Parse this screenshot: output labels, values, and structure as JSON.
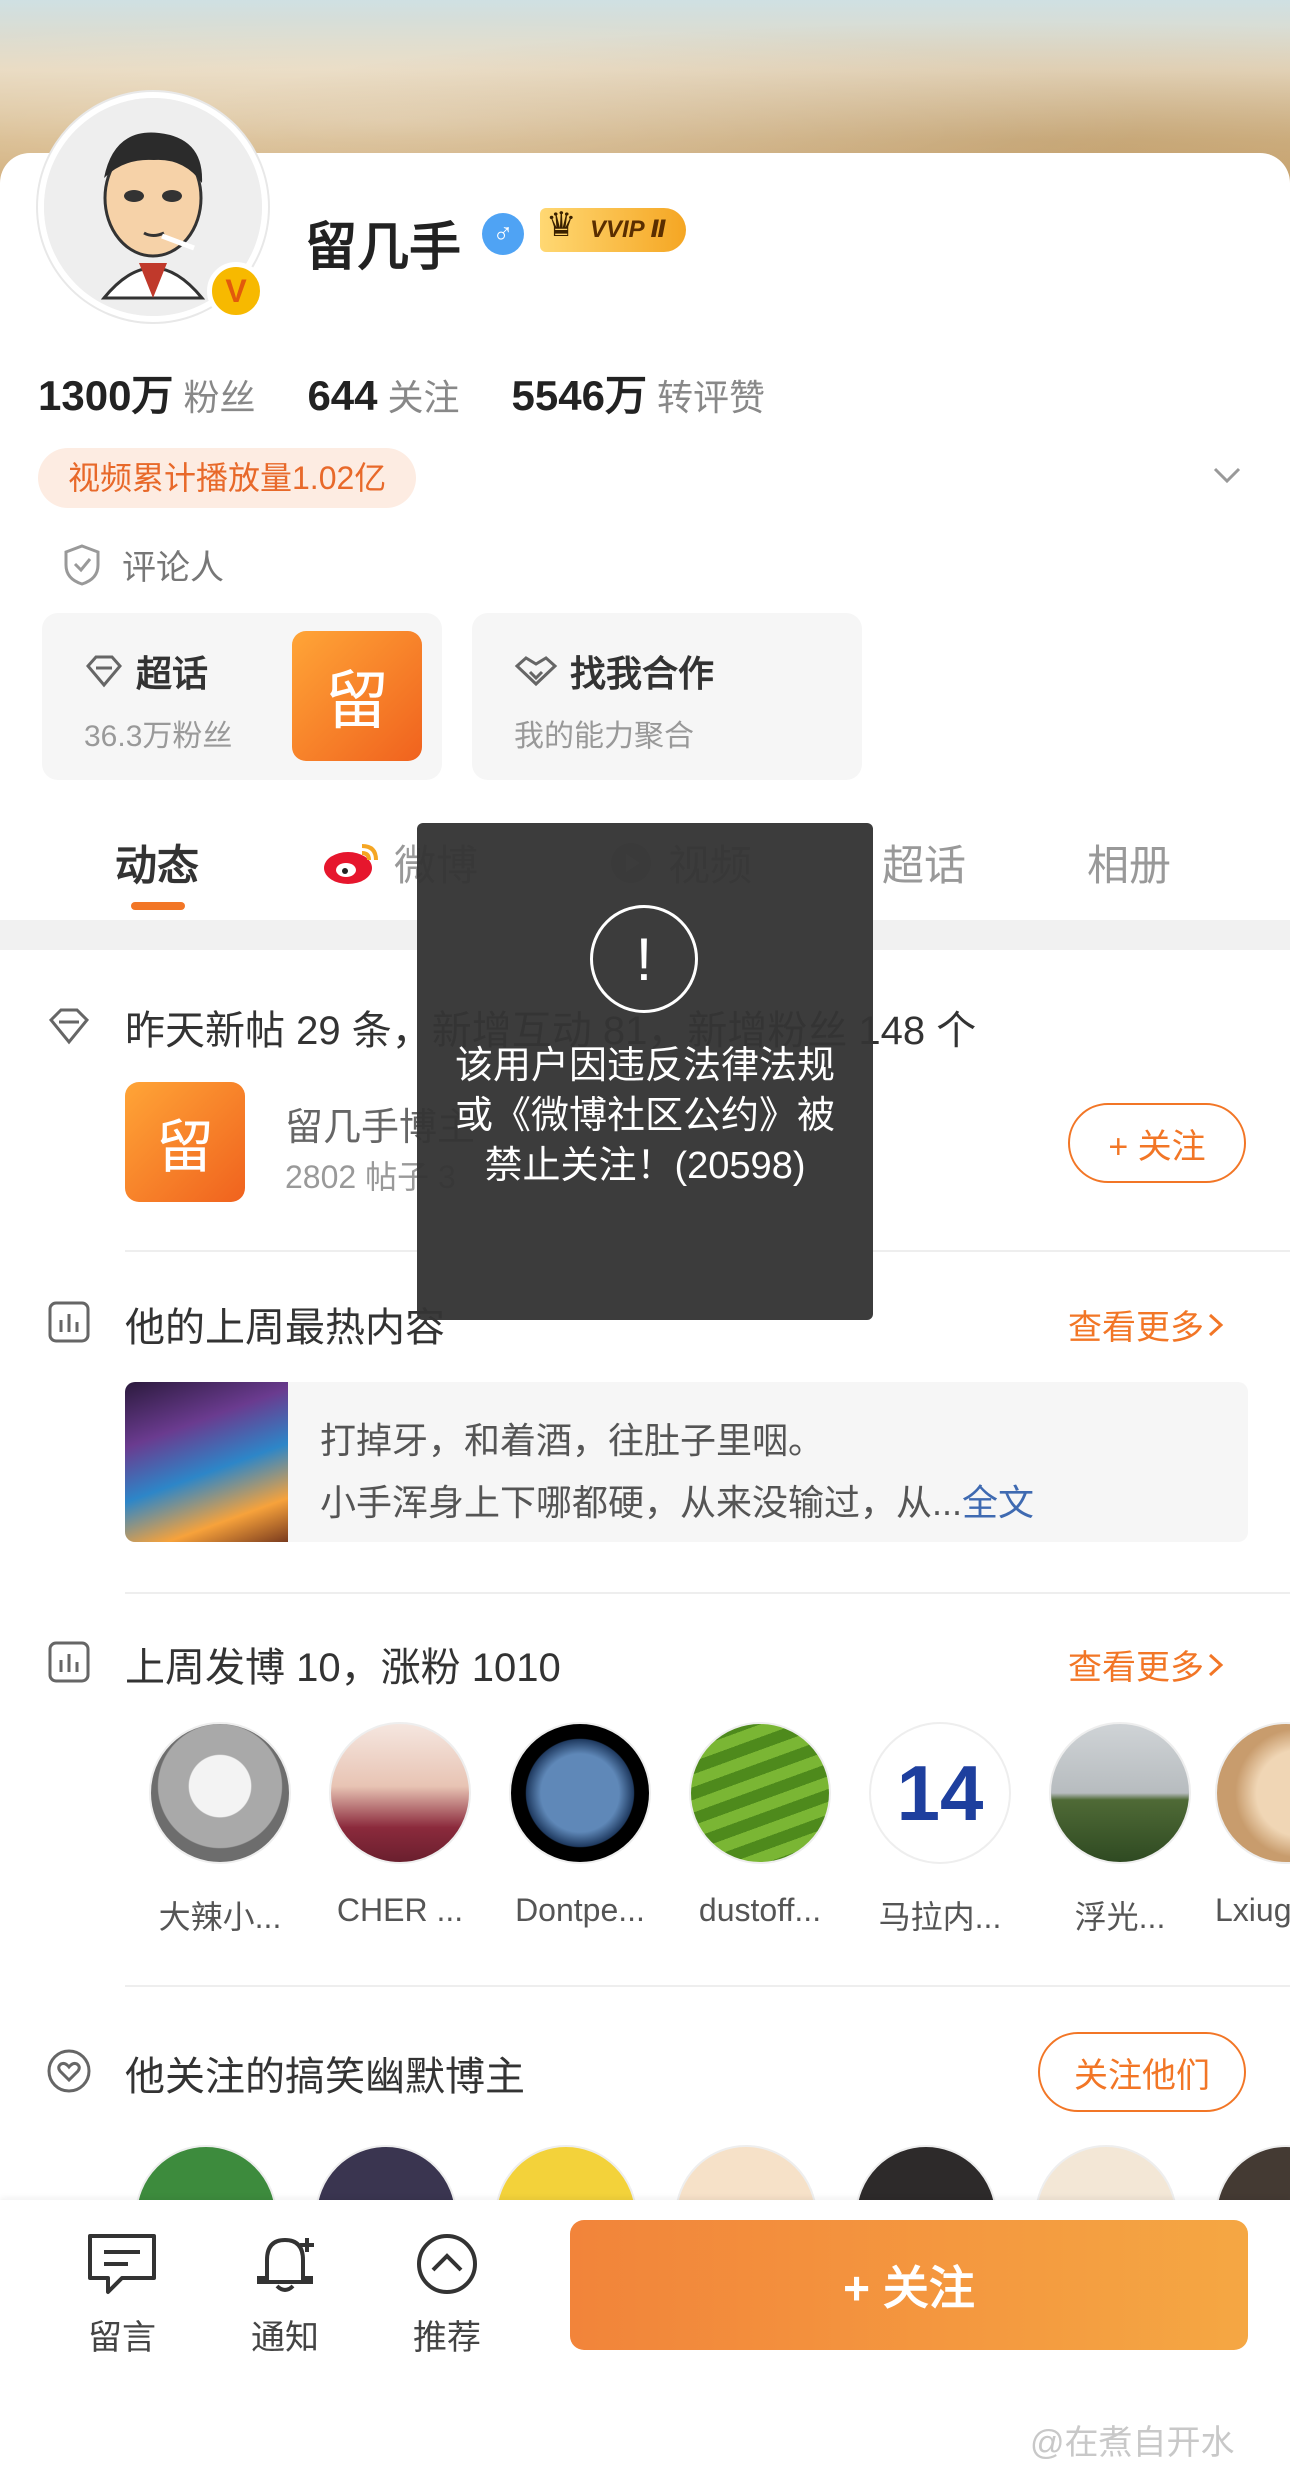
{
  "profile": {
    "name": "留几手",
    "vip_badge": "VVIP Ⅱ",
    "verified_mark": "V",
    "gender_symbol": "♂",
    "stats": [
      {
        "value": "1300万",
        "label": "粉丝"
      },
      {
        "value": "644",
        "label": "关注"
      },
      {
        "value": "5546万",
        "label": "转评赞"
      }
    ],
    "video_plays": "视频累计播放量1.02亿",
    "role": "评论人"
  },
  "tiles": {
    "supertopic": {
      "title": "超话",
      "sub": "36.3万粉丝",
      "logo": "留"
    },
    "cooperation": {
      "title": "找我合作",
      "sub": "我的能力聚合"
    }
  },
  "tabs": [
    {
      "label": "动态"
    },
    {
      "label": "微博"
    },
    {
      "label": "视频"
    },
    {
      "label": "超话"
    },
    {
      "label": "相册"
    }
  ],
  "activity": {
    "summary": "昨天新帖 29 条，新增互动 81，新增粉丝 148 个",
    "topic_logo": "留",
    "topic_name": "留几手博主",
    "topic_meta": "2802 帖子 3",
    "follow_label": "+ 关注"
  },
  "hot_content": {
    "title": "他的上周最热内容",
    "more": "查看更多",
    "line1": "打掉牙，和着酒，往肚子里咽。",
    "line2": "小手浑身上下哪都硬，从来没输过，从...",
    "full_text": "全文"
  },
  "weekly": {
    "title": "上周发博 10，涨粉 1010",
    "more": "查看更多",
    "friends": [
      {
        "name": "大辣小..."
      },
      {
        "name": "CHER ..."
      },
      {
        "name": "Dontpe..."
      },
      {
        "name": "dustoff..."
      },
      {
        "name": "马拉内..."
      },
      {
        "name": "浮光..."
      },
      {
        "name": "Lxiug"
      }
    ]
  },
  "humor": {
    "title": "他关注的搞笑幽默博主",
    "button": "关注他们"
  },
  "toast": {
    "icon": "!",
    "message": "该用户因违反法律法规或《微博社区公约》被禁止关注！(20598)"
  },
  "bottom_bar": {
    "message": "留言",
    "notify": "通知",
    "recommend": "推荐",
    "follow": "+ 关注"
  },
  "watermark": "@在煮自开水",
  "colors": {
    "accent": "#f27626",
    "link_blue": "#3f6ab1",
    "toast_bg": "#343434"
  }
}
